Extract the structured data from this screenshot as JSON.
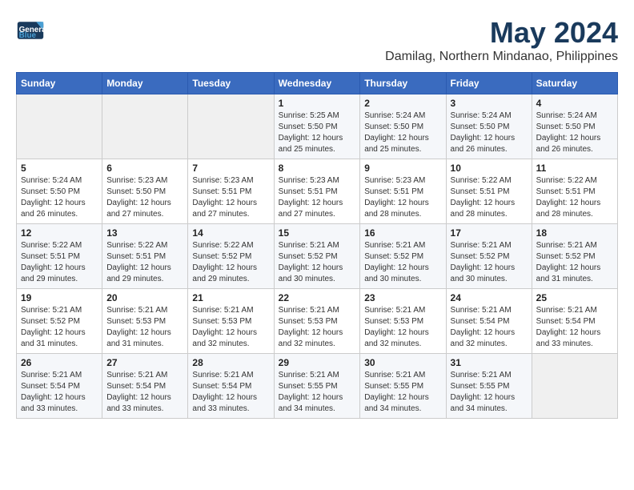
{
  "logo": {
    "line1": "General",
    "line2": "Blue"
  },
  "title": "May 2024",
  "location": "Damilag, Northern Mindanao, Philippines",
  "days_of_week": [
    "Sunday",
    "Monday",
    "Tuesday",
    "Wednesday",
    "Thursday",
    "Friday",
    "Saturday"
  ],
  "weeks": [
    [
      {
        "day": "",
        "info": ""
      },
      {
        "day": "",
        "info": ""
      },
      {
        "day": "",
        "info": ""
      },
      {
        "day": "1",
        "info": "Sunrise: 5:25 AM\nSunset: 5:50 PM\nDaylight: 12 hours\nand 25 minutes."
      },
      {
        "day": "2",
        "info": "Sunrise: 5:24 AM\nSunset: 5:50 PM\nDaylight: 12 hours\nand 25 minutes."
      },
      {
        "day": "3",
        "info": "Sunrise: 5:24 AM\nSunset: 5:50 PM\nDaylight: 12 hours\nand 26 minutes."
      },
      {
        "day": "4",
        "info": "Sunrise: 5:24 AM\nSunset: 5:50 PM\nDaylight: 12 hours\nand 26 minutes."
      }
    ],
    [
      {
        "day": "5",
        "info": "Sunrise: 5:24 AM\nSunset: 5:50 PM\nDaylight: 12 hours\nand 26 minutes."
      },
      {
        "day": "6",
        "info": "Sunrise: 5:23 AM\nSunset: 5:50 PM\nDaylight: 12 hours\nand 27 minutes."
      },
      {
        "day": "7",
        "info": "Sunrise: 5:23 AM\nSunset: 5:51 PM\nDaylight: 12 hours\nand 27 minutes."
      },
      {
        "day": "8",
        "info": "Sunrise: 5:23 AM\nSunset: 5:51 PM\nDaylight: 12 hours\nand 27 minutes."
      },
      {
        "day": "9",
        "info": "Sunrise: 5:23 AM\nSunset: 5:51 PM\nDaylight: 12 hours\nand 28 minutes."
      },
      {
        "day": "10",
        "info": "Sunrise: 5:22 AM\nSunset: 5:51 PM\nDaylight: 12 hours\nand 28 minutes."
      },
      {
        "day": "11",
        "info": "Sunrise: 5:22 AM\nSunset: 5:51 PM\nDaylight: 12 hours\nand 28 minutes."
      }
    ],
    [
      {
        "day": "12",
        "info": "Sunrise: 5:22 AM\nSunset: 5:51 PM\nDaylight: 12 hours\nand 29 minutes."
      },
      {
        "day": "13",
        "info": "Sunrise: 5:22 AM\nSunset: 5:51 PM\nDaylight: 12 hours\nand 29 minutes."
      },
      {
        "day": "14",
        "info": "Sunrise: 5:22 AM\nSunset: 5:52 PM\nDaylight: 12 hours\nand 29 minutes."
      },
      {
        "day": "15",
        "info": "Sunrise: 5:21 AM\nSunset: 5:52 PM\nDaylight: 12 hours\nand 30 minutes."
      },
      {
        "day": "16",
        "info": "Sunrise: 5:21 AM\nSunset: 5:52 PM\nDaylight: 12 hours\nand 30 minutes."
      },
      {
        "day": "17",
        "info": "Sunrise: 5:21 AM\nSunset: 5:52 PM\nDaylight: 12 hours\nand 30 minutes."
      },
      {
        "day": "18",
        "info": "Sunrise: 5:21 AM\nSunset: 5:52 PM\nDaylight: 12 hours\nand 31 minutes."
      }
    ],
    [
      {
        "day": "19",
        "info": "Sunrise: 5:21 AM\nSunset: 5:52 PM\nDaylight: 12 hours\nand 31 minutes."
      },
      {
        "day": "20",
        "info": "Sunrise: 5:21 AM\nSunset: 5:53 PM\nDaylight: 12 hours\nand 31 minutes."
      },
      {
        "day": "21",
        "info": "Sunrise: 5:21 AM\nSunset: 5:53 PM\nDaylight: 12 hours\nand 32 minutes."
      },
      {
        "day": "22",
        "info": "Sunrise: 5:21 AM\nSunset: 5:53 PM\nDaylight: 12 hours\nand 32 minutes."
      },
      {
        "day": "23",
        "info": "Sunrise: 5:21 AM\nSunset: 5:53 PM\nDaylight: 12 hours\nand 32 minutes."
      },
      {
        "day": "24",
        "info": "Sunrise: 5:21 AM\nSunset: 5:54 PM\nDaylight: 12 hours\nand 32 minutes."
      },
      {
        "day": "25",
        "info": "Sunrise: 5:21 AM\nSunset: 5:54 PM\nDaylight: 12 hours\nand 33 minutes."
      }
    ],
    [
      {
        "day": "26",
        "info": "Sunrise: 5:21 AM\nSunset: 5:54 PM\nDaylight: 12 hours\nand 33 minutes."
      },
      {
        "day": "27",
        "info": "Sunrise: 5:21 AM\nSunset: 5:54 PM\nDaylight: 12 hours\nand 33 minutes."
      },
      {
        "day": "28",
        "info": "Sunrise: 5:21 AM\nSunset: 5:54 PM\nDaylight: 12 hours\nand 33 minutes."
      },
      {
        "day": "29",
        "info": "Sunrise: 5:21 AM\nSunset: 5:55 PM\nDaylight: 12 hours\nand 34 minutes."
      },
      {
        "day": "30",
        "info": "Sunrise: 5:21 AM\nSunset: 5:55 PM\nDaylight: 12 hours\nand 34 minutes."
      },
      {
        "day": "31",
        "info": "Sunrise: 5:21 AM\nSunset: 5:55 PM\nDaylight: 12 hours\nand 34 minutes."
      },
      {
        "day": "",
        "info": ""
      }
    ]
  ]
}
